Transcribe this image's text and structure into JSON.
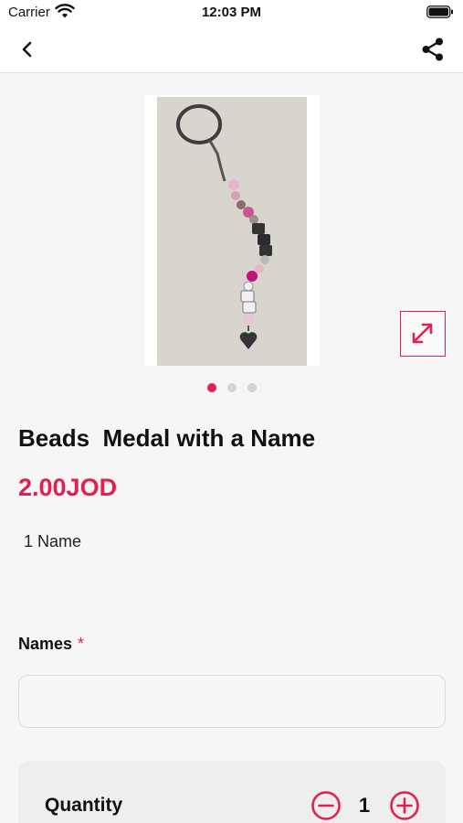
{
  "status_bar": {
    "carrier": "Carrier",
    "time": "12:03 PM"
  },
  "nav": {
    "back_icon": "chevron-left-icon",
    "share_icon": "share-icon"
  },
  "gallery": {
    "image_description": "product-photo",
    "page_count": 3,
    "active_page": 1,
    "expand_icon": "expand-arrows-icon"
  },
  "product": {
    "title": "Beads  Medal with a Name",
    "price": "2.00JOD",
    "description": "1 Name"
  },
  "form": {
    "names_label": "Names",
    "required_marker": "*",
    "names_value": "",
    "names_placeholder": ""
  },
  "quantity": {
    "label": "Quantity",
    "value": "1",
    "minus_icon": "minus-circle-icon",
    "plus_icon": "plus-circle-icon"
  },
  "colors": {
    "accent": "#e0214f",
    "background": "#f6f6f6",
    "text": "#111111"
  }
}
